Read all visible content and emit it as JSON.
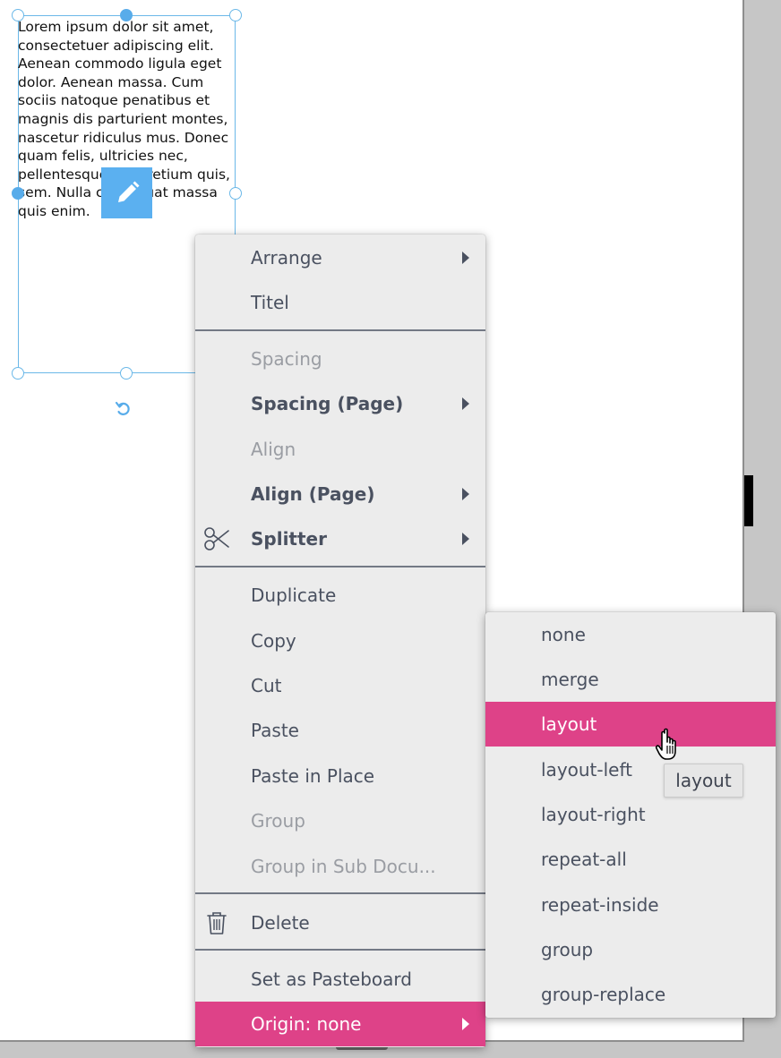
{
  "text_frame": {
    "body": "Lorem ipsum dolor sit amet, consectetuer adipiscing elit. Aenean commodo ligula eget dolor. Aenean massa. Cum sociis natoque penatibus et magnis dis parturient montes, nascetur ridiculus mus. Donec quam felis, ultricies nec, pellentesque eu, pretium quis, sem. Nulla consequat massa quis enim."
  },
  "icons": {
    "edit": "pencil-icon",
    "rotate": "rotate-icon",
    "splitter": "scissors-icon",
    "delete": "trash-icon",
    "submenu": "chevron-right-icon",
    "cursor": "hand-pointer-icon"
  },
  "colors": {
    "accent": "#de4288",
    "selection": "#6bb8e8",
    "edit_button": "#5bb0f0",
    "menu_bg": "#ececec"
  },
  "context_menu": {
    "arrange": "Arrange",
    "titel": "Titel",
    "spacing": "Spacing",
    "spacing_page": "Spacing (Page)",
    "align": "Align",
    "align_page": "Align (Page)",
    "splitter": "Splitter",
    "duplicate": "Duplicate",
    "copy": "Copy",
    "cut": "Cut",
    "paste": "Paste",
    "paste_in_place": "Paste in Place",
    "group": "Group",
    "group_in_sub": "Group in Sub Docu...",
    "delete": "Delete",
    "set_as_pasteboard": "Set as Pasteboard",
    "origin": "Origin: none"
  },
  "submenu": {
    "none": "none",
    "merge": "merge",
    "layout": "layout",
    "layout_left": "layout-left",
    "layout_right": "layout-right",
    "repeat_all": "repeat-all",
    "repeat_inside": "repeat-inside",
    "group": "group",
    "group_replace": "group-replace"
  },
  "tooltip": "layout"
}
